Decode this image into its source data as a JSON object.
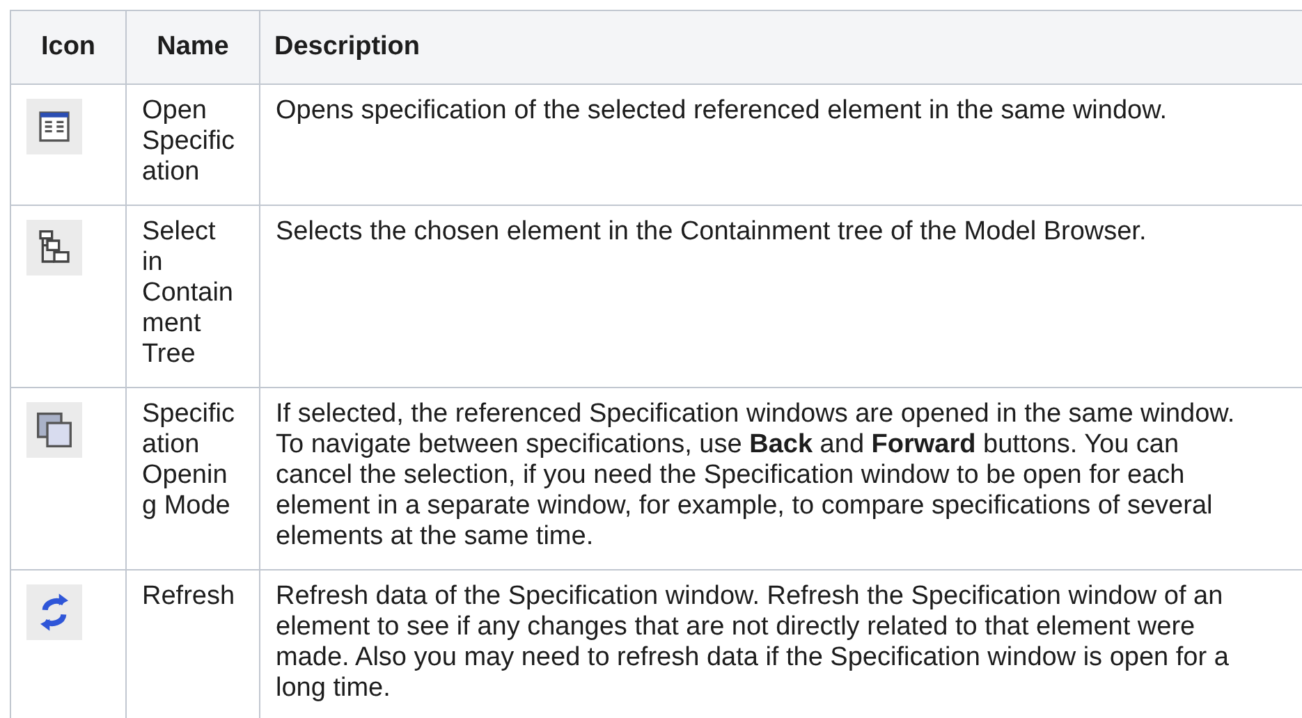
{
  "table": {
    "columns": [
      "Icon",
      "Name",
      "Description"
    ],
    "rows": [
      {
        "name": "Open Specification",
        "description": "Opens specification of the selected referenced element in the same window."
      },
      {
        "name": "Select in Containment Tree",
        "description": "Selects the chosen element in the Containment tree of the Model Browser."
      },
      {
        "name": "Specification Opening Mode",
        "description": "If selected, the referenced Specification windows are opened in the same window. To navigate between specifications, use **Back** and **Forward** buttons. You can cancel the selection, if you need the Specification window to be open for each element in a separate window, for example, to compare specifications of several elements at the same time."
      },
      {
        "name": "Refresh",
        "description": "Refresh data of the Specification window. Refresh the Specification window of an element to see if any changes that are not directly related to that element were made. Also you may need to refresh data if the Specification window is open for a long time."
      }
    ]
  }
}
